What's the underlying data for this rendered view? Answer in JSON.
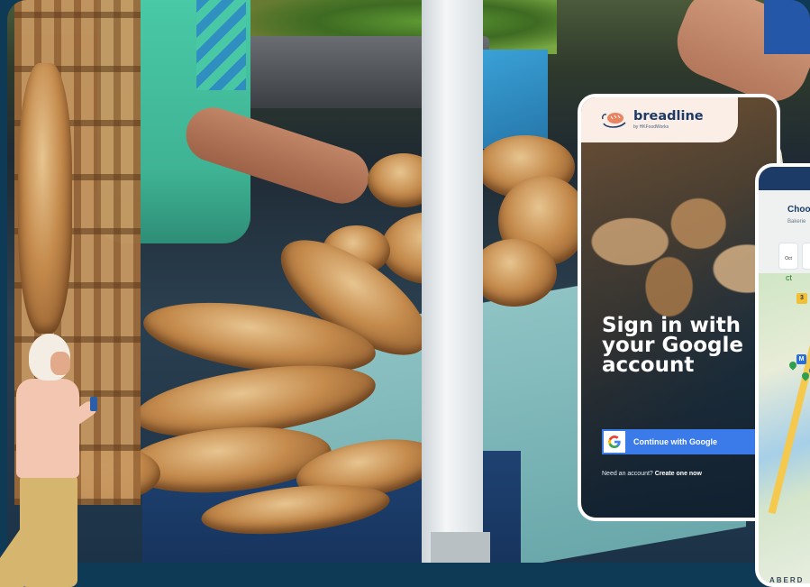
{
  "brand": {
    "name": "breadline",
    "tagline": "by HKFoodWorks",
    "colors": {
      "navy": "#1d3a66",
      "logo_bg": "#fbeee6",
      "google_blue": "#3b7be9",
      "page_bg": "#0f3a55"
    }
  },
  "signin": {
    "title": "Sign in with your Google account",
    "google_button_label": "Continue with Google",
    "google_icon": "google-g-icon",
    "need_account_text": "Need an account?",
    "create_link": "Create one now"
  },
  "map_screen": {
    "title": "Choo",
    "subtitle": "Bakerie",
    "chips": [
      "Oct",
      ""
    ],
    "route_badge": "3",
    "metro_badge": "M",
    "place_label": "ABERD",
    "map_side_label": "ct"
  }
}
